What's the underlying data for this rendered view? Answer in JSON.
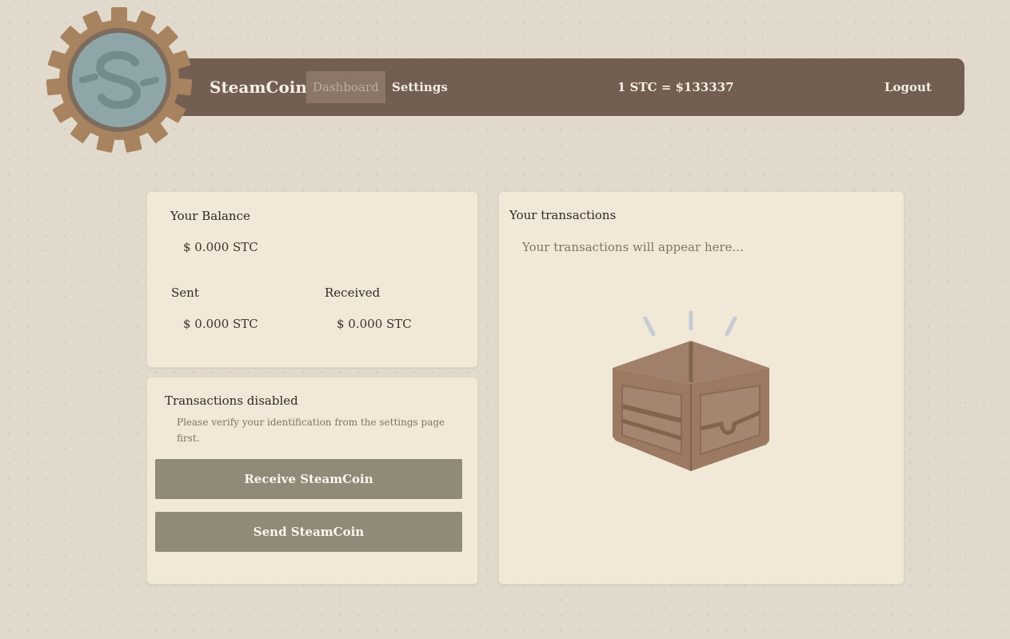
{
  "header": {
    "brand": "SteamCoin",
    "nav": {
      "dashboard": "Dashboard",
      "settings": "Settings"
    },
    "rate": "1 STC = $133337",
    "logout": "Logout",
    "logo_icon": "gear-coin-icon"
  },
  "balance": {
    "title": "Your Balance",
    "amount": "$ 0.000 STC",
    "sent_label": "Sent",
    "sent_amount": "$ 0.000 STC",
    "received_label": "Received",
    "received_amount": "$ 0.000 STC"
  },
  "actions": {
    "title": "Transactions disabled",
    "message": "Please verify your identification from the settings page first.",
    "receive_button": "Receive SteamCoin",
    "send_button": "Send SteamCoin"
  },
  "transactions": {
    "title": "Your transactions",
    "empty_text": "Your transactions will appear here...",
    "empty_icon": "empty-box-icon"
  },
  "colors": {
    "page_background": "#e2d9cd",
    "nav_bar": "#735e52",
    "nav_active": "#8b7668",
    "card": "#f2e8d8",
    "button": "#918a78",
    "gear": "#a88360",
    "coin": "#8fa6a8"
  }
}
